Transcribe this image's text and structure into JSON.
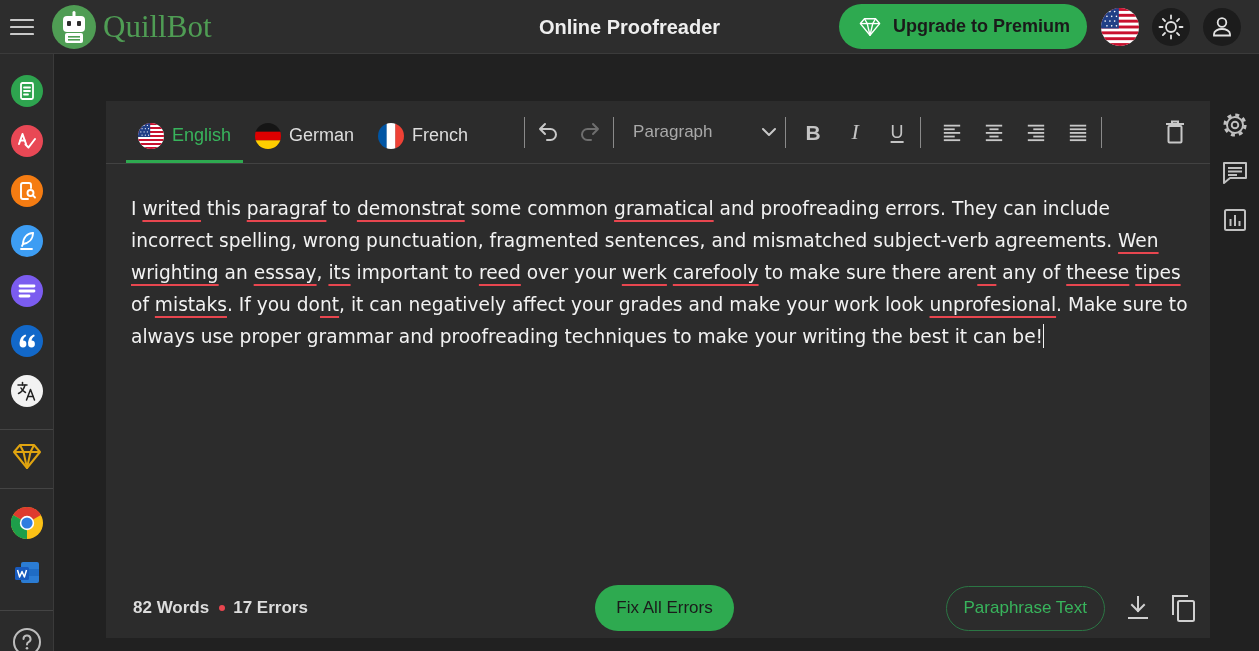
{
  "top_bar": {
    "logo_text": "QuillBot",
    "title": "Online Proofreader",
    "upgrade_button": "Upgrade to Premium"
  },
  "language_tabs": [
    {
      "label": "English",
      "selected": true
    },
    {
      "label": "German",
      "selected": false
    },
    {
      "label": "French",
      "selected": false
    }
  ],
  "toolbar": {
    "history": [
      {
        "kind": "undo",
        "disabled": false
      },
      {
        "kind": "redo",
        "disabled": true
      }
    ],
    "block_format": {
      "value": "Paragraph"
    },
    "format_buttons": [
      {
        "kind": "bold",
        "label": "B"
      },
      {
        "kind": "italic",
        "label": "I"
      },
      {
        "kind": "underline",
        "label": "U"
      }
    ]
  },
  "editor": {
    "segments": [
      {
        "text": "I",
        "error": false,
        "attached": true
      },
      {
        "text": "writed",
        "error": true,
        "attached": false
      },
      {
        "text": "this",
        "error": false,
        "attached": false
      },
      {
        "text": "paragraf",
        "error": true,
        "attached": false
      },
      {
        "text": "to",
        "error": false,
        "attached": false
      },
      {
        "text": "demonstrat",
        "error": true,
        "attached": false
      },
      {
        "text": "some common",
        "error": false,
        "attached": false
      },
      {
        "text": "gramatical",
        "error": true,
        "attached": false
      },
      {
        "text": "and proofreading errors. They can include incorrect spelling, wrong punctuation, fragmented sentences, and mismatched subject-verb agreements.",
        "error": false,
        "attached": false
      },
      {
        "text": "Wen",
        "error": true,
        "attached": false
      },
      {
        "text": "wrighting",
        "error": true,
        "attached": false
      },
      {
        "text": "an",
        "error": false,
        "attached": false
      },
      {
        "text": "esssay",
        "error": true,
        "attached": false
      },
      {
        "text": ",",
        "error": false,
        "attached": true
      },
      {
        "text": "its",
        "error": true,
        "attached": false
      },
      {
        "text": "important to",
        "error": false,
        "attached": false
      },
      {
        "text": "reed",
        "error": true,
        "attached": false
      },
      {
        "text": "over your",
        "error": false,
        "attached": false
      },
      {
        "text": "werk",
        "error": true,
        "attached": false
      },
      {
        "text": "carefooly",
        "error": true,
        "attached": false
      },
      {
        "text": "to make sure there are",
        "error": false,
        "attached": false
      },
      {
        "text": "nt",
        "error": true,
        "attached": true
      },
      {
        "text": "any of",
        "error": false,
        "attached": false
      },
      {
        "text": "theese",
        "error": true,
        "attached": false
      },
      {
        "text": "tipes",
        "error": true,
        "attached": false
      },
      {
        "text": "of",
        "error": false,
        "attached": false
      },
      {
        "text": "mistaks",
        "error": true,
        "attached": false
      },
      {
        "text": ". If you do",
        "error": false,
        "attached": true
      },
      {
        "text": "nt",
        "error": true,
        "attached": true
      },
      {
        "text": ", it can negatively affect your grades and make your work look",
        "error": false,
        "attached": true
      },
      {
        "text": "unprofesional",
        "error": true,
        "attached": false
      },
      {
        "text": ". Make sure to always use proper grammar and proofreading techniques to make your writing the best it can be!",
        "error": false,
        "attached": true
      }
    ]
  },
  "footer": {
    "word_count": "82 Words",
    "error_count": "17 Errors",
    "fix_button": "Fix All Errors",
    "paraphrase_button": "Paraphrase Text"
  }
}
